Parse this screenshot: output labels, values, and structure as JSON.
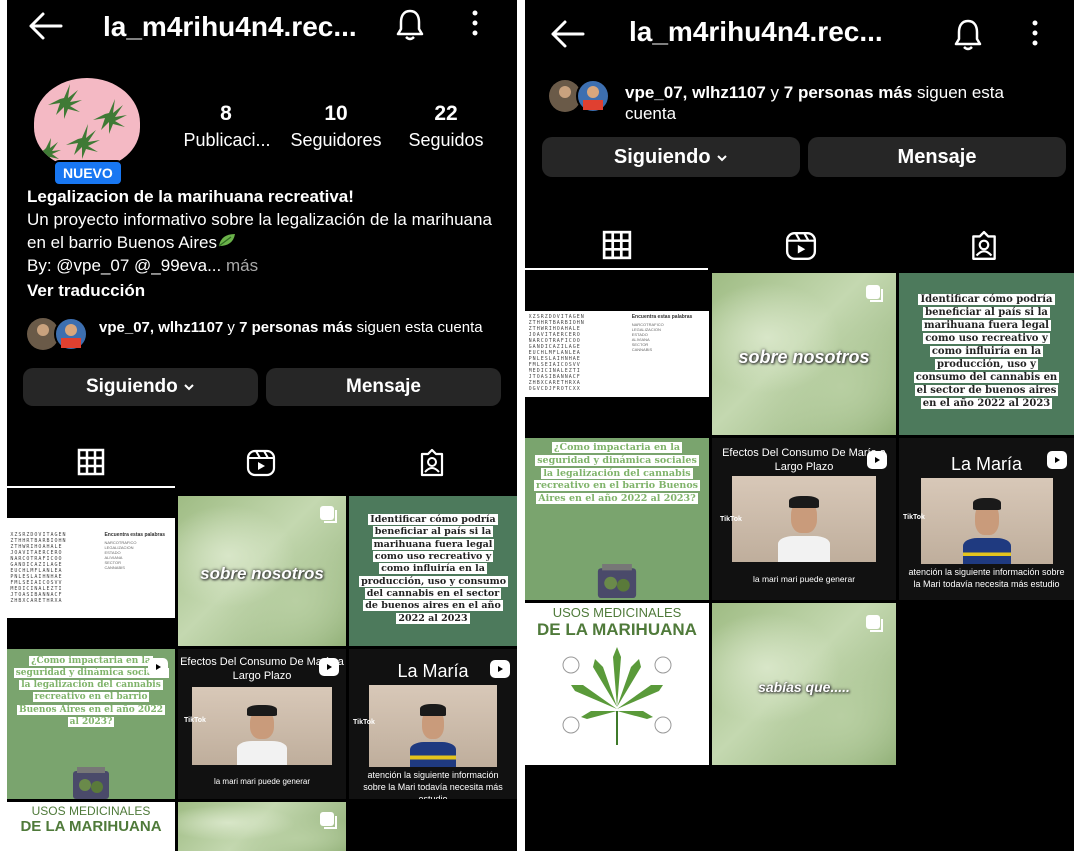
{
  "profile": {
    "username": "la_m4rihu4n4.rec...",
    "badge": "NUEVO",
    "stats": [
      {
        "value": "8",
        "label": "Publicaci..."
      },
      {
        "value": "10",
        "label": "Seguidores"
      },
      {
        "value": "22",
        "label": "Seguidos"
      }
    ],
    "bio_name": "Legalizacion de la marihuana recreativa!",
    "bio_line": "Un proyecto informativo sobre la legalización de la marihuana en el barrio Buenos Aires",
    "bio_by": "By: @vpe_07 @_99eva...",
    "bio_more": "más",
    "translate": "Ver traducción",
    "followed_users": "vpe_07, wlhz1107",
    "followed_mid": " y ",
    "followed_count": "7 personas más",
    "followed_tail": " siguen esta cuenta"
  },
  "buttons": {
    "following": "Siguiendo",
    "message": "Mensaje"
  },
  "tabs": [
    "grid-icon",
    "reels-icon",
    "tagged-icon"
  ],
  "posts": {
    "wordsearch_title": "Encuentra estas palabras",
    "wordsearch_rows": [
      "XZSRZDOVITAGEN",
      "ZTHHRTBARBIOHN",
      "ZTHWRIHOAHALE",
      "JOAVITAERCERO",
      "NARCOTRAFICOO",
      "GANDICAZILAGE",
      "EUCHLMFLANLEA",
      "PNLESLAIHNHAE",
      "FMLSEIAICOSVV",
      "MEDICINALEZTI",
      "JTOASIBANNACF",
      "ZHBXCARETHRXA",
      "OGVCDJFROTCXX"
    ],
    "wordsearch_words": [
      "NARCOTRAFICO",
      "LEGALIZACION",
      "ESTADO",
      "ALIVIANA",
      "SECTOR",
      "CANNABIS",
      "MEDICINAL",
      "LEGAL",
      "CBD",
      "PERMITIDO",
      "POSITIVO",
      "INFECTO"
    ],
    "sobre": "sobre nosotros",
    "identificar": "Identificar cómo podría beneficiar al país si la marihuana fuera legal como uso recreativo y como influiría en la producción, uso y consumo del cannabis en el sector de buenos aires en el año 2022 al 2023",
    "impacto": "¿Como impactaria en la seguridad y dinámica sociales la legalización del cannabis recreativo en el barrio Buenos Aires en el año 2022 al 2023?",
    "efectos_title": "Efectos Del Consumo De María a Largo Plazo",
    "efectos_caption": "la mari mari puede generar",
    "lamaria_title": "La María",
    "lamaria_caption": "atención la siguiente información sobre la Mari todavía necesita más estudio",
    "tiktok": "TikTok",
    "usos_1": "USOS MEDICINALES",
    "usos_2": "DE LA MARIHUANA",
    "sabias": "sabías que....."
  },
  "colors": {
    "background": "#000000",
    "button": "#262626",
    "badge": "#1877f2",
    "muted": "#a8a8a8"
  }
}
